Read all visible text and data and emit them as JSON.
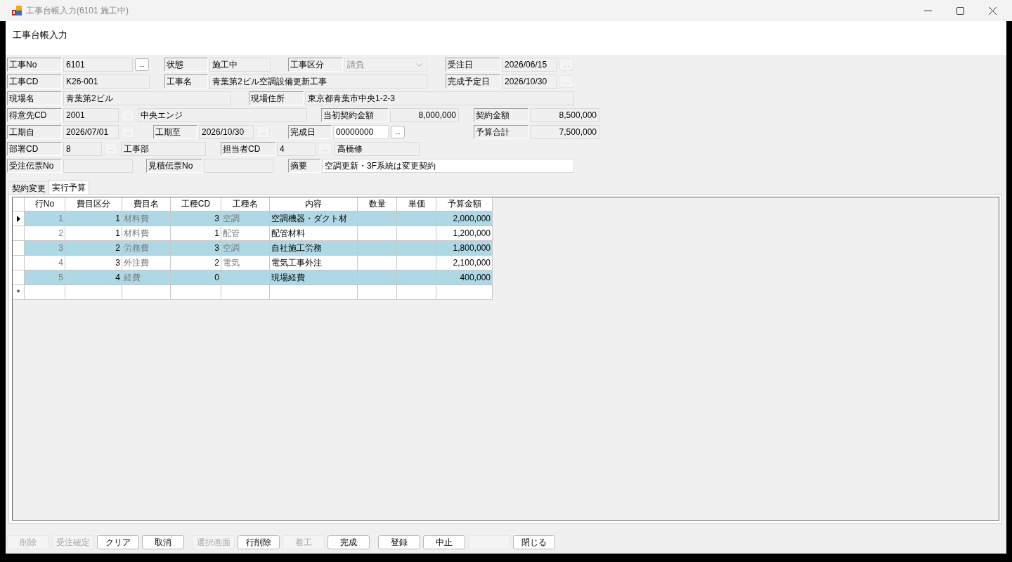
{
  "window": {
    "title": "工事台帳入力(6101 施工中)"
  },
  "header": {
    "title": "工事台帳入力"
  },
  "form": {
    "rows": [
      {
        "items": [
          {
            "kind": "label",
            "text": "工事No"
          },
          {
            "kind": "field",
            "text": "6101",
            "editable": false
          },
          {
            "kind": "button",
            "text": "...",
            "disabled": false
          },
          {
            "kind": "label",
            "text": "状態"
          },
          {
            "kind": "field",
            "text": "施工中",
            "editable": false
          },
          {
            "kind": "label",
            "text": "工事区分"
          },
          {
            "kind": "combo",
            "text": "請負",
            "disabled": true
          },
          {
            "kind": "label",
            "text": "受注日"
          },
          {
            "kind": "field",
            "text": "2026/06/15",
            "editable": false
          },
          {
            "kind": "button",
            "text": "...",
            "disabled": true
          }
        ]
      },
      {
        "items": [
          {
            "kind": "label",
            "text": "工事CD"
          },
          {
            "kind": "field",
            "text": "K26-001",
            "editable": false
          },
          {
            "kind": "label",
            "text": "工事名"
          },
          {
            "kind": "field",
            "text": "青葉第2ビル空調設備更新工事",
            "editable": false
          },
          {
            "kind": "label",
            "text": "完成予定日"
          },
          {
            "kind": "field",
            "text": "2026/10/30",
            "editable": false
          },
          {
            "kind": "button",
            "text": "...",
            "disabled": true
          }
        ]
      },
      {
        "items": [
          {
            "kind": "label",
            "text": "現場名"
          },
          {
            "kind": "field",
            "text": "青葉第2ビル",
            "editable": false
          },
          {
            "kind": "label",
            "text": "現場住所"
          },
          {
            "kind": "field",
            "text": "東京都青葉市中央1-2-3",
            "editable": false
          }
        ]
      },
      {
        "items": [
          {
            "kind": "label",
            "text": "得意先CD"
          },
          {
            "kind": "field",
            "text": "2001",
            "editable": false
          },
          {
            "kind": "button",
            "text": "...",
            "disabled": true
          },
          {
            "kind": "field",
            "text": "中央エンジ",
            "editable": false
          },
          {
            "kind": "label",
            "text": "当初契約金額"
          },
          {
            "kind": "amount",
            "text": "8,000,000",
            "editable": false
          },
          {
            "kind": "label",
            "text": "契約金額"
          },
          {
            "kind": "amount",
            "text": "8,500,000",
            "editable": false
          }
        ]
      },
      {
        "items": [
          {
            "kind": "label",
            "text": "工期自"
          },
          {
            "kind": "field",
            "text": "2026/07/01",
            "editable": false
          },
          {
            "kind": "button",
            "text": "...",
            "disabled": true
          },
          {
            "kind": "label",
            "text": "工期至"
          },
          {
            "kind": "field",
            "text": "2026/10/30",
            "editable": false
          },
          {
            "kind": "button",
            "text": "...",
            "disabled": true
          },
          {
            "kind": "label",
            "text": "完成日"
          },
          {
            "kind": "field",
            "text": "00000000",
            "editable": true
          },
          {
            "kind": "button",
            "text": "...",
            "disabled": false
          },
          {
            "kind": "label",
            "text": "予算合計"
          },
          {
            "kind": "amount",
            "text": "7,500,000",
            "editable": false
          }
        ]
      },
      {
        "items": [
          {
            "kind": "label",
            "text": "部署CD"
          },
          {
            "kind": "field",
            "text": "8",
            "editable": false
          },
          {
            "kind": "button",
            "text": "...",
            "disabled": true
          },
          {
            "kind": "field",
            "text": "工事部",
            "editable": false
          },
          {
            "kind": "label",
            "text": "担当者CD"
          },
          {
            "kind": "field",
            "text": "4",
            "editable": false
          },
          {
            "kind": "button",
            "text": "...",
            "disabled": true
          },
          {
            "kind": "field",
            "text": "高橋修",
            "editable": false
          }
        ]
      },
      {
        "items": [
          {
            "kind": "label",
            "text": "受注伝票No"
          },
          {
            "kind": "field",
            "editable": false
          },
          {
            "kind": "label",
            "text": "見積伝票No"
          },
          {
            "kind": "field",
            "editable": false
          },
          {
            "kind": "label",
            "text": "摘要"
          },
          {
            "kind": "field",
            "text": "空調更新・3F系統は変更契約",
            "editable": true
          }
        ]
      }
    ]
  },
  "tabs": [
    {
      "label": "契約変更",
      "selected": false
    },
    {
      "label": "実行予算",
      "selected": true
    }
  ],
  "grid": {
    "columns": [
      {
        "label": "行No",
        "kind": "number",
        "readonly": true
      },
      {
        "label": "費目区分",
        "kind": "number",
        "readonly": false
      },
      {
        "label": "費目名",
        "kind": "text",
        "readonly": true
      },
      {
        "label": "工種CD",
        "kind": "number",
        "readonly": false
      },
      {
        "label": "工種名",
        "kind": "text",
        "readonly": true
      },
      {
        "label": "内容",
        "kind": "text",
        "readonly": false
      },
      {
        "label": "数量",
        "kind": "number"
      },
      {
        "label": "単価",
        "kind": "number"
      },
      {
        "label": "予算金額",
        "kind": "number",
        "readonly": false
      }
    ],
    "rows": [
      {
        "current": true,
        "cells": [
          "1",
          "1",
          "材料費",
          "3",
          "空調",
          "空調機器・ダクト材",
          null,
          null,
          "2,000,000"
        ]
      },
      {
        "current": false,
        "cells": [
          "2",
          "1",
          "材料費",
          "1",
          "配管",
          "配管材料",
          null,
          null,
          "1,200,000"
        ]
      },
      {
        "current": false,
        "cells": [
          "3",
          "2",
          "労務費",
          "3",
          "空調",
          "自社施工労務",
          null,
          null,
          "1,800,000"
        ]
      },
      {
        "current": false,
        "cells": [
          "4",
          "3",
          "外注費",
          "2",
          "電気",
          "電気工事外注",
          null,
          null,
          "2,100,000"
        ]
      },
      {
        "current": false,
        "cells": [
          "5",
          "4",
          "経費",
          "0",
          null,
          "現場経費",
          null,
          null,
          "400,000"
        ]
      }
    ],
    "new_row_marker": "*"
  },
  "buttons": [
    [
      {
        "label": "削除",
        "disabled": true
      },
      {
        "label": "受注確定",
        "disabled": true
      },
      {
        "label": "クリア",
        "disabled": false
      },
      {
        "label": "取消",
        "disabled": false
      }
    ],
    [
      {
        "label": "選択画面",
        "disabled": true
      },
      {
        "label": "行削除",
        "disabled": false
      },
      {
        "label": "着工",
        "disabled": true
      },
      {
        "label": "完成",
        "disabled": false
      }
    ],
    [
      {
        "label": "登録",
        "disabled": false
      },
      {
        "label": "中止",
        "disabled": false
      },
      {
        "disabled": true
      },
      {
        "label": "閉じる",
        "disabled": false
      }
    ]
  ]
}
